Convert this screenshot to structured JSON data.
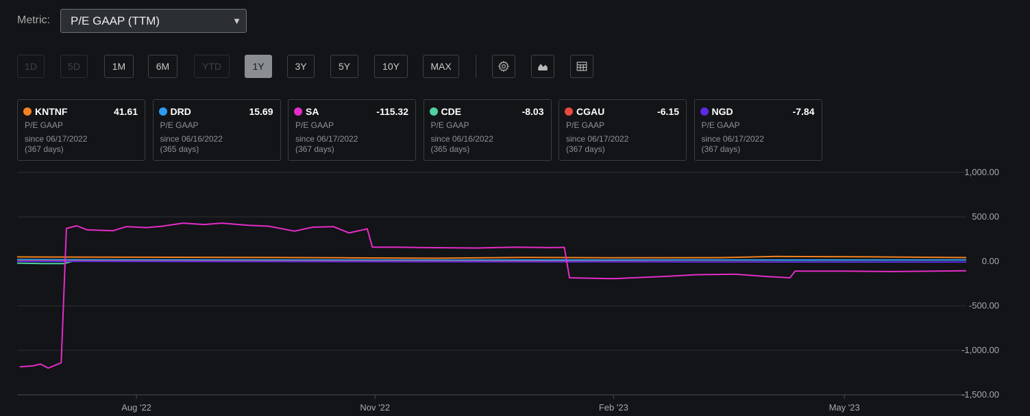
{
  "metric": {
    "label": "Metric:",
    "selected": "P/E GAAP (TTM)"
  },
  "ranges": [
    {
      "label": "1D",
      "state": "disabled"
    },
    {
      "label": "5D",
      "state": "disabled"
    },
    {
      "label": "1M",
      "state": "normal"
    },
    {
      "label": "6M",
      "state": "normal"
    },
    {
      "label": "YTD",
      "state": "disabled"
    },
    {
      "label": "1Y",
      "state": "active"
    },
    {
      "label": "3Y",
      "state": "normal"
    },
    {
      "label": "5Y",
      "state": "normal"
    },
    {
      "label": "10Y",
      "state": "normal"
    },
    {
      "label": "MAX",
      "state": "normal"
    }
  ],
  "tools": [
    "gear-icon",
    "area-chart-icon",
    "table-icon"
  ],
  "cards": [
    {
      "ticker": "KNTNF",
      "value": "41.61",
      "metric": "P/E GAAP",
      "since": "since 06/17/2022",
      "days": "(367 days)",
      "color": "#f5821f"
    },
    {
      "ticker": "DRD",
      "value": "15.69",
      "metric": "P/E GAAP",
      "since": "since 06/16/2022",
      "days": "(365 days)",
      "color": "#2e9bf0"
    },
    {
      "ticker": "SA",
      "value": "-115.32",
      "metric": "P/E GAAP",
      "since": "since 06/17/2022",
      "days": "(367 days)",
      "color": "#e62cc8"
    },
    {
      "ticker": "CDE",
      "value": "-8.03",
      "metric": "P/E GAAP",
      "since": "since 06/16/2022",
      "days": "(365 days)",
      "color": "#4fd1a0"
    },
    {
      "ticker": "CGAU",
      "value": "-6.15",
      "metric": "P/E GAAP",
      "since": "since 06/17/2022",
      "days": "(367 days)",
      "color": "#e84a3c"
    },
    {
      "ticker": "NGD",
      "value": "-7.84",
      "metric": "P/E GAAP",
      "since": "since 06/17/2022",
      "days": "(367 days)",
      "color": "#5a2be0"
    }
  ],
  "chart_data": {
    "type": "line",
    "x_domain": [
      "2022-06-16",
      "2023-06-17"
    ],
    "x_ticks": [
      {
        "label": "Aug '22",
        "date": "2022-08-01"
      },
      {
        "label": "Nov '22",
        "date": "2022-11-01"
      },
      {
        "label": "Feb '23",
        "date": "2023-02-01"
      },
      {
        "label": "May '23",
        "date": "2023-05-01"
      }
    ],
    "y_ticks": [
      "1,000.00",
      "500.00",
      "0.00",
      "-500.00",
      "-1,000.00",
      "-1,500.00"
    ],
    "y_tick_values": [
      1000,
      500,
      0,
      -500,
      -1000,
      -1500
    ],
    "ylim": [
      -1500,
      1000
    ],
    "grid": true,
    "series": [
      {
        "name": "KNTNF",
        "color": "#f5821f",
        "points": [
          [
            "2022-06-16",
            50
          ],
          [
            "2022-08-01",
            47
          ],
          [
            "2022-09-15",
            45
          ],
          [
            "2022-10-20",
            40
          ],
          [
            "2022-11-25",
            35
          ],
          [
            "2022-12-31",
            45
          ],
          [
            "2023-01-31",
            40
          ],
          [
            "2023-03-15",
            42
          ],
          [
            "2023-04-05",
            55
          ],
          [
            "2023-05-15",
            50
          ],
          [
            "2023-06-17",
            42
          ]
        ]
      },
      {
        "name": "DRD",
        "color": "#2e9bf0",
        "points": [
          [
            "2022-06-16",
            20
          ],
          [
            "2022-08-01",
            18
          ],
          [
            "2022-12-01",
            15
          ],
          [
            "2023-03-01",
            16
          ],
          [
            "2023-06-17",
            16
          ]
        ]
      },
      {
        "name": "CDE",
        "color": "#4fd1a0",
        "points": [
          [
            "2022-06-16",
            -20
          ],
          [
            "2022-06-26",
            -25
          ],
          [
            "2022-07-04",
            -25
          ],
          [
            "2022-07-08",
            5
          ],
          [
            "2023-06-17",
            -8
          ]
        ]
      },
      {
        "name": "CGAU",
        "color": "#e84a3c",
        "points": [
          [
            "2022-06-16",
            5
          ],
          [
            "2022-12-31",
            0
          ],
          [
            "2023-04-05",
            -6
          ]
        ]
      },
      {
        "name": "NGD",
        "color": "#5a2be0",
        "points": [
          [
            "2022-06-16",
            0
          ],
          [
            "2022-12-31",
            -5
          ],
          [
            "2023-06-17",
            -8
          ]
        ]
      },
      {
        "name": "SA",
        "color": "#e62cc8",
        "points": [
          [
            "2022-06-17",
            -1185
          ],
          [
            "2022-06-22",
            -1175
          ],
          [
            "2022-06-25",
            -1155
          ],
          [
            "2022-06-28",
            -1200
          ],
          [
            "2022-07-03",
            -1140
          ],
          [
            "2022-07-05",
            370
          ],
          [
            "2022-07-09",
            400
          ],
          [
            "2022-07-13",
            355
          ],
          [
            "2022-07-23",
            345
          ],
          [
            "2022-07-28",
            390
          ],
          [
            "2022-08-05",
            380
          ],
          [
            "2022-08-11",
            395
          ],
          [
            "2022-08-19",
            430
          ],
          [
            "2022-08-27",
            415
          ],
          [
            "2022-09-03",
            430
          ],
          [
            "2022-09-13",
            405
          ],
          [
            "2022-09-21",
            395
          ],
          [
            "2022-10-01",
            340
          ],
          [
            "2022-10-08",
            385
          ],
          [
            "2022-10-16",
            390
          ],
          [
            "2022-10-22",
            320
          ],
          [
            "2022-10-29",
            365
          ],
          [
            "2022-10-31",
            160
          ],
          [
            "2022-11-10",
            160
          ],
          [
            "2022-11-20",
            155
          ],
          [
            "2022-12-10",
            150
          ],
          [
            "2022-12-25",
            160
          ],
          [
            "2023-01-08",
            155
          ],
          [
            "2023-01-13",
            158
          ],
          [
            "2023-01-15",
            -185
          ],
          [
            "2023-02-01",
            -195
          ],
          [
            "2023-02-20",
            -170
          ],
          [
            "2023-03-05",
            -150
          ],
          [
            "2023-03-20",
            -145
          ],
          [
            "2023-04-01",
            -170
          ],
          [
            "2023-04-10",
            -185
          ],
          [
            "2023-04-12",
            -110
          ],
          [
            "2023-05-01",
            -110
          ],
          [
            "2023-05-20",
            -115
          ],
          [
            "2023-06-17",
            -105
          ]
        ]
      }
    ]
  }
}
